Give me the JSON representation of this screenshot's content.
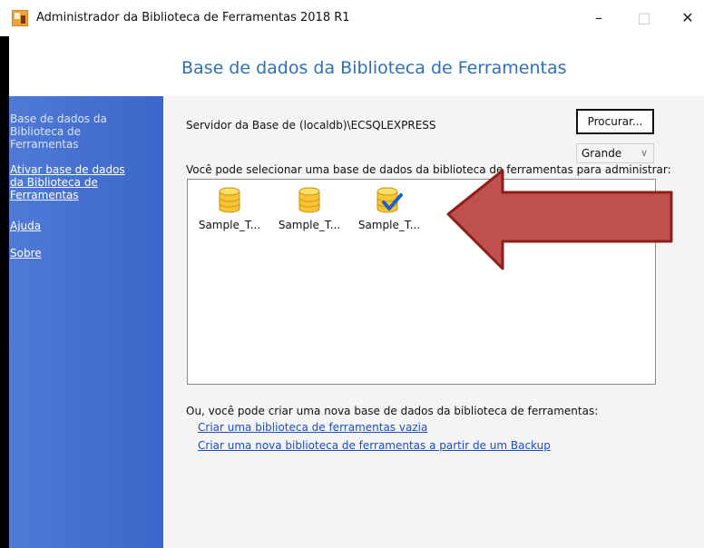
{
  "window": {
    "title": "Administrador da Biblioteca de Ferramentas 2018 R1",
    "buttons": {
      "minimize": "–",
      "maximize": "□",
      "close": "✕"
    }
  },
  "header": {
    "title": "Base de dados da Biblioteca de Ferramentas"
  },
  "sidebar": {
    "items": [
      {
        "lines": [
          "Base de dados da",
          "Biblioteca de",
          "Ferramentas"
        ],
        "link": false
      },
      {
        "lines": [
          "Ativar base de dados",
          "da Biblioteca de",
          "Ferramentas"
        ],
        "link": true
      },
      {
        "lines": [
          "Ajuda"
        ],
        "link": true
      },
      {
        "lines": [
          "Sobre"
        ],
        "link": true
      }
    ]
  },
  "main": {
    "server_label": "Servidor da Base de",
    "server_value": "(localdb)\\ECSQLEXPRESS",
    "browse_button": "Procurar...",
    "view_select": "Grande",
    "select_prompt": "Você pode selecionar uma base de dados da biblioteca de ferramentas para administrar:",
    "databases": [
      {
        "label": "Sample_T...",
        "icon": "database-icon",
        "checked": false
      },
      {
        "label": "Sample_T...",
        "icon": "database-icon",
        "checked": false
      },
      {
        "label": "Sample_T...",
        "icon": "database-check-icon",
        "checked": true
      }
    ],
    "create_prompt": "Ou, você pode criar uma nova base de dados da biblioteca de ferramentas:",
    "create_empty_link": "Criar uma biblioteca de ferramentas vazia",
    "create_backup_link": "Criar uma nova biblioteca de ferramentas a partir de um Backup"
  },
  "annotation": {
    "arrow_color": "#c0504d",
    "arrow_stroke": "#8a1f1b"
  }
}
